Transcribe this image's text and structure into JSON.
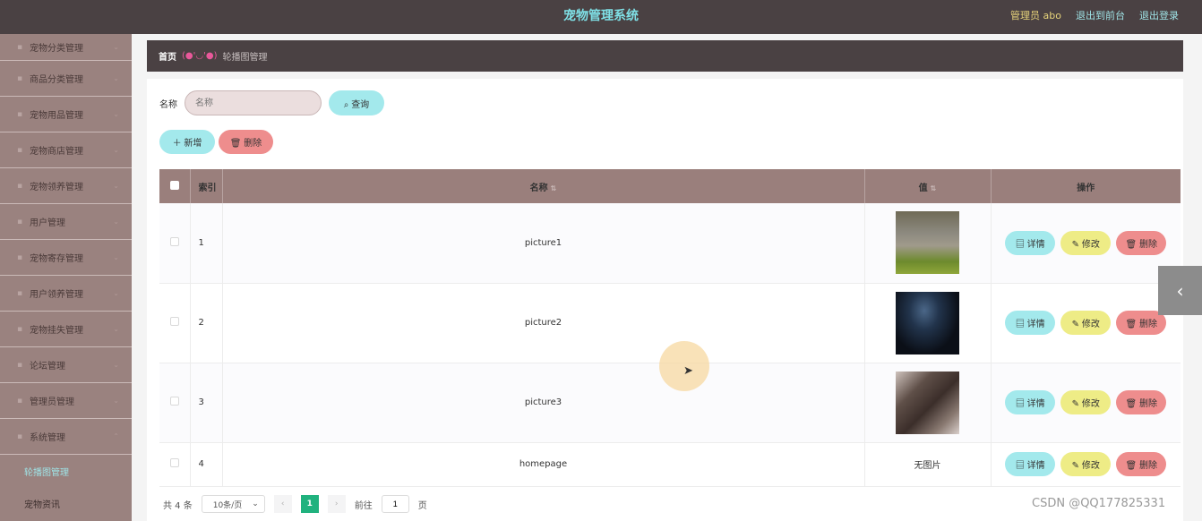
{
  "header": {
    "title": "宠物管理系统",
    "user": "管理员 abo",
    "to_front": "退出到前台",
    "logout": "退出登录"
  },
  "sidebar": {
    "items": [
      {
        "label": "宠物分类管理"
      },
      {
        "label": "商品分类管理"
      },
      {
        "label": "宠物用品管理"
      },
      {
        "label": "宠物商店管理"
      },
      {
        "label": "宠物领养管理"
      },
      {
        "label": "用户管理"
      },
      {
        "label": "宠物寄存管理"
      },
      {
        "label": "用户领养管理"
      },
      {
        "label": "宠物挂失管理"
      },
      {
        "label": "论坛管理"
      },
      {
        "label": "管理员管理"
      },
      {
        "label": "系统管理"
      }
    ],
    "sub_items": [
      {
        "label": "轮播图管理"
      },
      {
        "label": "宠物资讯"
      }
    ]
  },
  "breadcrumb": {
    "home": "首页",
    "sep": "(●'◡'●)",
    "current": "轮播图管理"
  },
  "search": {
    "label": "名称",
    "placeholder": "名称",
    "button": "查询"
  },
  "actions": {
    "add": "新增",
    "delete": "删除"
  },
  "table": {
    "headers": {
      "index": "索引",
      "name": "名称",
      "value": "值",
      "ops": "操作"
    },
    "rows": [
      {
        "index": "1",
        "name": "picture1",
        "value": ""
      },
      {
        "index": "2",
        "name": "picture2",
        "value": ""
      },
      {
        "index": "3",
        "name": "picture3",
        "value": ""
      },
      {
        "index": "4",
        "name": "homepage",
        "value": "无图片"
      }
    ],
    "op_labels": {
      "detail": "详情",
      "edit": "修改",
      "delete": "删除"
    }
  },
  "pager": {
    "total": "共 4 条",
    "page_size": "10条/页",
    "current": "1",
    "goto_label": "前往",
    "goto_value": "1",
    "page_unit": "页"
  },
  "watermark": "CSDN @QQ177825331"
}
